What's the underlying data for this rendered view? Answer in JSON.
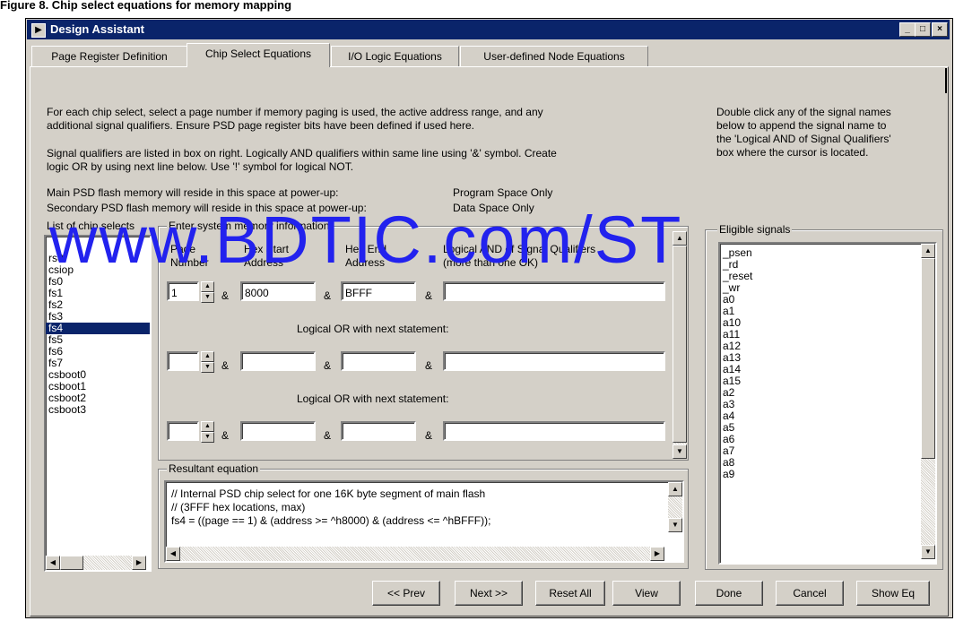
{
  "page_caption": "Figure 8. Chip select equations for memory mapping",
  "window": {
    "title": "Design Assistant",
    "min": "_",
    "max": "□",
    "close": "×"
  },
  "tabs": [
    {
      "label": "Page Register Definition"
    },
    {
      "label": "Chip Select Equations"
    },
    {
      "label": "I/O Logic Equations"
    },
    {
      "label": "User-defined Node Equations"
    }
  ],
  "instructions": {
    "p1_l1": "For each chip select, select a page number if memory paging is used, the active address range, and any",
    "p1_l2": "additional signal qualifiers. Ensure PSD page register bits have been defined if used here.",
    "p2_l1": "Signal qualifiers are listed in box on right. Logically AND qualifiers within same line using '&' symbol. Create",
    "p2_l2": "logic OR by using next line below. Use '!' symbol for logical NOT.",
    "main_label": "Main PSD flash memory will reside in this space at power-up:",
    "main_value": "Program Space Only",
    "secondary_label": "Secondary PSD flash memory will reside in this space at power-up:",
    "secondary_value": "Data Space Only",
    "right_l1": "Double click any of the signal names",
    "right_l2": "below to append the signal name to",
    "right_l3": "the 'Logical AND of Signal Qualifiers'",
    "right_l4": "box where the cursor is located."
  },
  "chip_selects": {
    "label": "List of chip selects",
    "items": [
      "rs0",
      "csiop",
      "fs0",
      "fs1",
      "fs2",
      "fs3",
      "fs4",
      "fs5",
      "fs6",
      "fs7",
      "csboot0",
      "csboot1",
      "csboot2",
      "csboot3"
    ],
    "selected": "fs4"
  },
  "memory_info": {
    "label": "Enter system memory information",
    "col_page_l1": "Page",
    "col_page_l2": "Number",
    "col_start_l1": "Hex Start",
    "col_start_l2": "Address",
    "col_end_l1": "Hex End",
    "col_end_l2": "Address",
    "col_qual_l1": "Logical AND of Signal Qualifiers",
    "col_qual_l2": "(more than one OK)",
    "amp": "&",
    "or_text": "Logical OR with next statement:",
    "rows": [
      {
        "page": "1",
        "start": "8000",
        "end": "BFFF",
        "qual": ""
      },
      {
        "page": "",
        "start": "",
        "end": "",
        "qual": ""
      },
      {
        "page": "",
        "start": "",
        "end": "",
        "qual": ""
      }
    ]
  },
  "resultant": {
    "label": "Resultant equation",
    "line1": "// Internal PSD chip select for one 16K byte segment of main flash",
    "line2": "// (3FFF hex locations, max)",
    "line3": "fs4 = ((page == 1) & (address >= ^h8000) & (address <= ^hBFFF));"
  },
  "eligible": {
    "label": "Eligible signals",
    "items": [
      "_psen",
      "_rd",
      "_reset",
      "_wr",
      "a0",
      "a1",
      "a10",
      "a11",
      "a12",
      "a13",
      "a14",
      "a15",
      "a2",
      "a3",
      "a4",
      "a5",
      "a6",
      "a7",
      "a8",
      "a9"
    ]
  },
  "buttons": {
    "prev": "<< Prev",
    "next": "Next >>",
    "reset_all": "Reset All",
    "view": "View",
    "done": "Done",
    "cancel": "Cancel",
    "show_eq": "Show Eq"
  },
  "watermark": "www.BDTIC.com/ST",
  "colors": {
    "titlebar": "#0a246a",
    "face": "#d4d0c8",
    "selection": "#0a246a",
    "watermark": "#2222ee"
  }
}
